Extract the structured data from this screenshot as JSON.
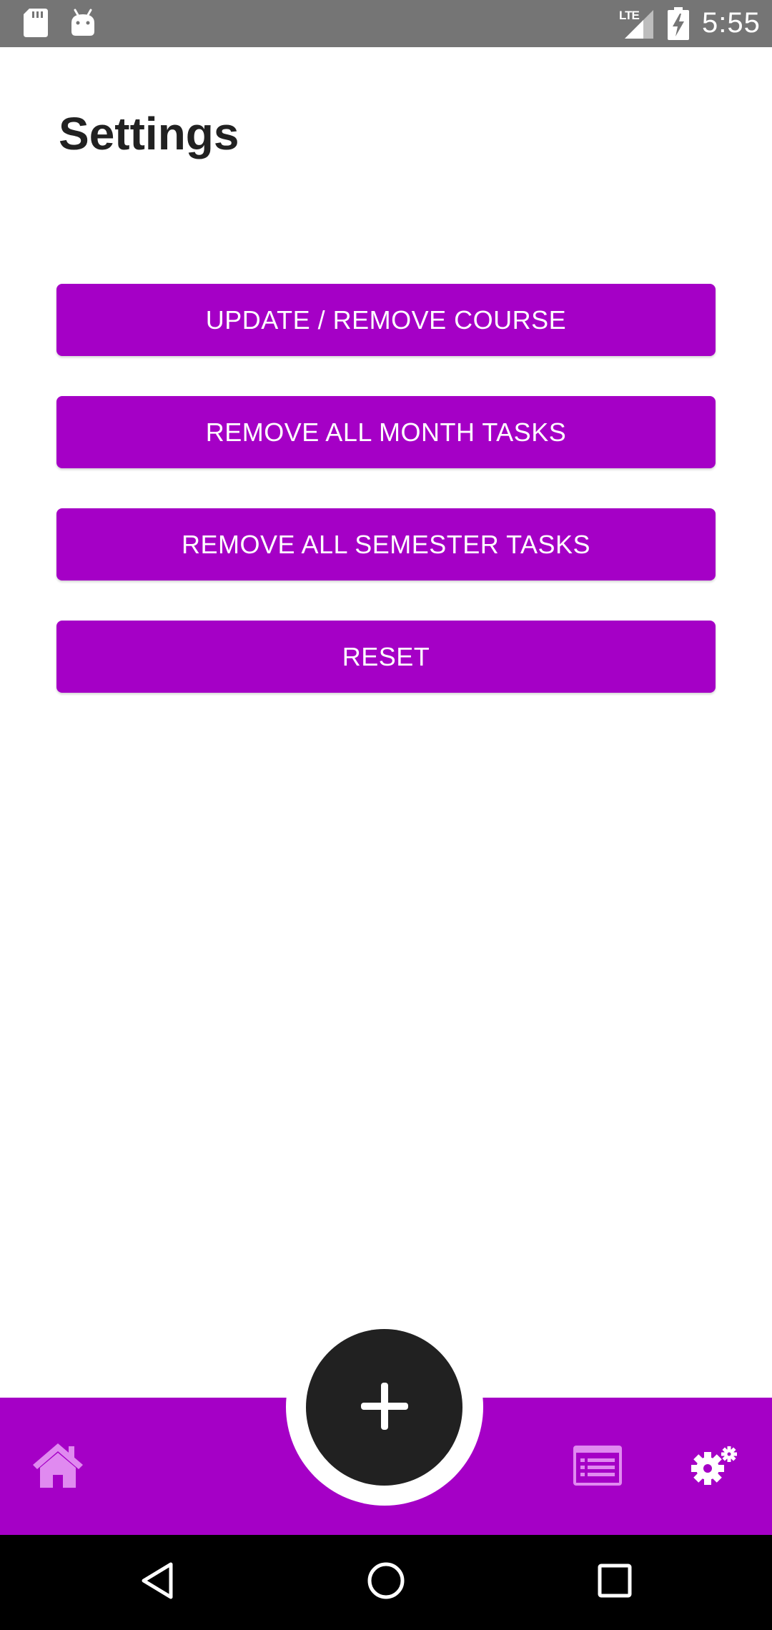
{
  "status_bar": {
    "network_label": "LTE",
    "time": "5:55",
    "icons": [
      "sd-card-icon",
      "android-icon",
      "signal-icon",
      "battery-charging-icon"
    ]
  },
  "page": {
    "title": "Settings"
  },
  "buttons": {
    "update_remove_course": "UPDATE / REMOVE COURSE",
    "remove_month_tasks": "REMOVE ALL MONTH TASKS",
    "remove_semester_tasks": "REMOVE ALL SEMESTER TASKS",
    "reset": "RESET"
  },
  "bottom_nav": {
    "items": [
      "home-icon",
      "task-list-icon",
      "settings-icon"
    ],
    "fab_icon": "plus-icon"
  },
  "system_nav": {
    "items": [
      "back-icon",
      "home-circle-icon",
      "recents-icon"
    ]
  },
  "colors": {
    "accent": "#a500c6",
    "inactive_icon": "#e08af0",
    "status_bar": "#757575",
    "fab": "#212121",
    "title_text": "#212121"
  }
}
